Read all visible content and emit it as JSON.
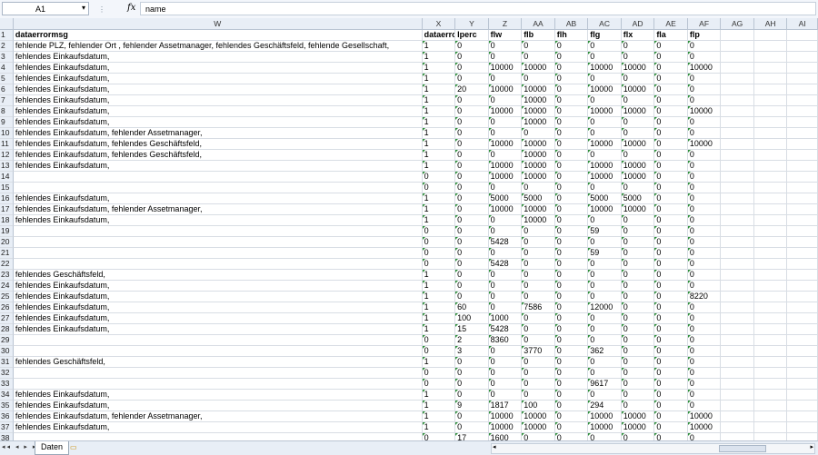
{
  "formula_bar": {
    "cell_ref": "A1",
    "fx_label": "fx",
    "content": "name"
  },
  "columns": [
    "W",
    "X",
    "Y",
    "Z",
    "AA",
    "AB",
    "AC",
    "AD",
    "AE",
    "AF",
    "AG",
    "AH",
    "AI"
  ],
  "headers": [
    "dataerrormsg",
    "dataerror",
    "lperc",
    "flw",
    "flb",
    "flh",
    "flg",
    "flx",
    "fla",
    "flp"
  ],
  "rows": [
    [
      "2",
      "fehlende PLZ, fehlender Ort  , fehlender Assetmanager, fehlendes Geschäftsfeld, fehlende Gesellschaft,",
      "1",
      "0",
      "0",
      "0",
      "0",
      "0",
      "0",
      "0",
      "0"
    ],
    [
      "3",
      "fehlendes Einkaufsdatum,",
      "1",
      "0",
      "0",
      "0",
      "0",
      "0",
      "0",
      "0",
      "0"
    ],
    [
      "4",
      "fehlendes Einkaufsdatum,",
      "1",
      "0",
      "10000",
      "10000",
      "0",
      "10000",
      "10000",
      "0",
      "10000"
    ],
    [
      "5",
      "fehlendes Einkaufsdatum,",
      "1",
      "0",
      "0",
      "0",
      "0",
      "0",
      "0",
      "0",
      "0"
    ],
    [
      "6",
      "fehlendes Einkaufsdatum,",
      "1",
      "20",
      "10000",
      "10000",
      "0",
      "10000",
      "10000",
      "0",
      "0"
    ],
    [
      "7",
      "fehlendes Einkaufsdatum,",
      "1",
      "0",
      "0",
      "10000",
      "0",
      "0",
      "0",
      "0",
      "0"
    ],
    [
      "8",
      "fehlendes Einkaufsdatum,",
      "1",
      "0",
      "10000",
      "10000",
      "0",
      "10000",
      "10000",
      "0",
      "10000"
    ],
    [
      "9",
      "fehlendes Einkaufsdatum,",
      "1",
      "0",
      "0",
      "10000",
      "0",
      "0",
      "0",
      "0",
      "0"
    ],
    [
      "10",
      "fehlendes Einkaufsdatum, fehlender Assetmanager,",
      "1",
      "0",
      "0",
      "0",
      "0",
      "0",
      "0",
      "0",
      "0"
    ],
    [
      "11",
      "fehlendes Einkaufsdatum, fehlendes Geschäftsfeld,",
      "1",
      "0",
      "10000",
      "10000",
      "0",
      "10000",
      "10000",
      "0",
      "10000"
    ],
    [
      "12",
      "fehlendes Einkaufsdatum, fehlendes Geschäftsfeld,",
      "1",
      "0",
      "0",
      "10000",
      "0",
      "0",
      "0",
      "0",
      "0"
    ],
    [
      "13",
      "fehlendes Einkaufsdatum,",
      "1",
      "0",
      "10000",
      "10000",
      "0",
      "10000",
      "10000",
      "0",
      "0"
    ],
    [
      "14",
      "",
      "0",
      "0",
      "10000",
      "10000",
      "0",
      "10000",
      "10000",
      "0",
      "0"
    ],
    [
      "15",
      "",
      "0",
      "0",
      "0",
      "0",
      "0",
      "0",
      "0",
      "0",
      "0"
    ],
    [
      "16",
      "fehlendes Einkaufsdatum,",
      "1",
      "0",
      "5000",
      "5000",
      "0",
      "5000",
      "5000",
      "0",
      "0"
    ],
    [
      "17",
      "fehlendes Einkaufsdatum, fehlender Assetmanager,",
      "1",
      "0",
      "10000",
      "10000",
      "0",
      "10000",
      "10000",
      "0",
      "0"
    ],
    [
      "18",
      "fehlendes Einkaufsdatum,",
      "1",
      "0",
      "0",
      "10000",
      "0",
      "0",
      "0",
      "0",
      "0"
    ],
    [
      "19",
      "",
      "0",
      "0",
      "0",
      "0",
      "0",
      "59",
      "0",
      "0",
      "0"
    ],
    [
      "20",
      "",
      "0",
      "0",
      "5428",
      "0",
      "0",
      "0",
      "0",
      "0",
      "0"
    ],
    [
      "21",
      "",
      "0",
      "0",
      "0",
      "0",
      "0",
      "59",
      "0",
      "0",
      "0"
    ],
    [
      "22",
      "",
      "0",
      "0",
      "5428",
      "0",
      "0",
      "0",
      "0",
      "0",
      "0"
    ],
    [
      "23",
      "fehlendes Geschäftsfeld,",
      "1",
      "0",
      "0",
      "0",
      "0",
      "0",
      "0",
      "0",
      "0"
    ],
    [
      "24",
      "fehlendes Einkaufsdatum,",
      "1",
      "0",
      "0",
      "0",
      "0",
      "0",
      "0",
      "0",
      "0"
    ],
    [
      "25",
      "fehlendes Einkaufsdatum,",
      "1",
      "0",
      "0",
      "0",
      "0",
      "0",
      "0",
      "0",
      "8220"
    ],
    [
      "26",
      "fehlendes Einkaufsdatum,",
      "1",
      "60",
      "0",
      "7586",
      "0",
      "12000",
      "0",
      "0",
      "0"
    ],
    [
      "27",
      "fehlendes Einkaufsdatum,",
      "1",
      "100",
      "1000",
      "0",
      "0",
      "0",
      "0",
      "0",
      "0"
    ],
    [
      "28",
      "fehlendes Einkaufsdatum,",
      "1",
      "15",
      "5428",
      "0",
      "0",
      "0",
      "0",
      "0",
      "0"
    ],
    [
      "29",
      "",
      "0",
      "2",
      "8360",
      "0",
      "0",
      "0",
      "0",
      "0",
      "0"
    ],
    [
      "30",
      "",
      "0",
      "3",
      "0",
      "3770",
      "0",
      "362",
      "0",
      "0",
      "0"
    ],
    [
      "31",
      "fehlendes Geschäftsfeld,",
      "1",
      "0",
      "0",
      "0",
      "0",
      "0",
      "0",
      "0",
      "0"
    ],
    [
      "32",
      "",
      "0",
      "0",
      "0",
      "0",
      "0",
      "0",
      "0",
      "0",
      "0"
    ],
    [
      "33",
      "",
      "0",
      "0",
      "0",
      "0",
      "0",
      "9617",
      "0",
      "0",
      "0"
    ],
    [
      "34",
      "fehlendes Einkaufsdatum,",
      "1",
      "0",
      "0",
      "0",
      "0",
      "0",
      "0",
      "0",
      "0"
    ],
    [
      "35",
      "fehlendes Einkaufsdatum,",
      "1",
      "9",
      "1817",
      "100",
      "0",
      "294",
      "0",
      "0",
      "0"
    ],
    [
      "36",
      "fehlendes Einkaufsdatum, fehlender Assetmanager,",
      "1",
      "0",
      "10000",
      "10000",
      "0",
      "10000",
      "10000",
      "0",
      "10000"
    ],
    [
      "37",
      "fehlendes Einkaufsdatum,",
      "1",
      "0",
      "10000",
      "10000",
      "0",
      "10000",
      "10000",
      "0",
      "10000"
    ],
    [
      "38",
      "",
      "0",
      "17",
      "1600",
      "0",
      "0",
      "0",
      "0",
      "0",
      "0"
    ]
  ],
  "sheet_tab": "Daten",
  "colors": {
    "grid_header_bg": "#e8eef6",
    "error_triangle": "#2f8f3a"
  }
}
